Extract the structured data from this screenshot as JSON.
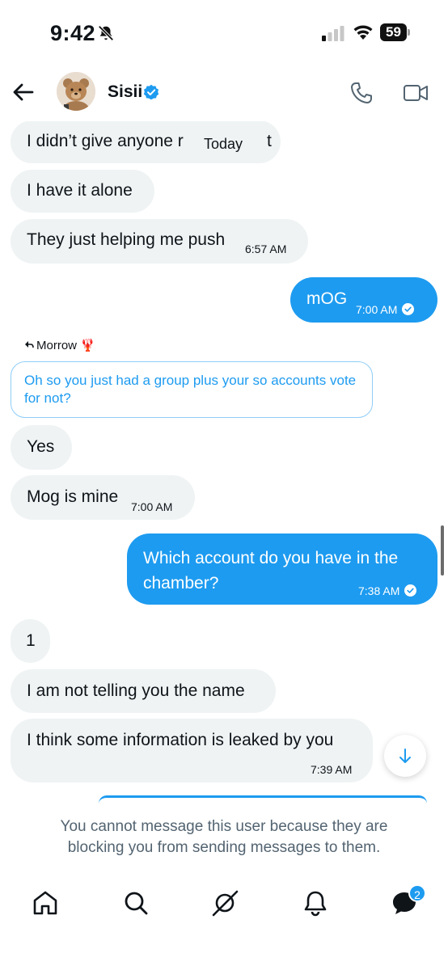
{
  "status_bar": {
    "time": "9:42",
    "battery": "59",
    "icons": [
      "bell-slash-icon",
      "cellular-signal-icon",
      "wifi-icon",
      "battery-icon"
    ]
  },
  "header": {
    "name": "Sisii",
    "verified": true,
    "icons": [
      "back-arrow-icon",
      "avatar",
      "verified-badge-icon",
      "phone-icon",
      "video-camera-icon"
    ]
  },
  "date_divider": "Today",
  "messages": {
    "m1": {
      "text": "I didn’t give anyone r",
      "tail": "t"
    },
    "m2": {
      "text": "I have it alone"
    },
    "m3": {
      "text": "They just helping me push",
      "time": "6:57 AM"
    },
    "m4": {
      "text": "mOG",
      "time": "7:00 AM"
    },
    "reply_to": {
      "name": "Morrow",
      "emoji": "🦞",
      "quote": "Oh so you just had a group plus your so accounts vote for not?"
    },
    "m5": {
      "text": "Yes"
    },
    "m6": {
      "text": "Mog is mine",
      "time": "7:00 AM"
    },
    "m7": {
      "text": "Which account do you have in the chamber?",
      "time": "7:38 AM"
    },
    "m8": {
      "text": "1"
    },
    "m9": {
      "text": "I am not telling you the name"
    },
    "m10": {
      "text": "I think some information is leaked by you",
      "time": "7:39 AM"
    }
  },
  "blocked_notice": "You cannot message this user because they are blocking you from sending messages to them.",
  "tabbar": {
    "items": [
      "home-icon",
      "search-icon",
      "grok-icon",
      "notifications-bell-icon",
      "messages-icon"
    ],
    "messages_badge": "2"
  },
  "colors": {
    "accent": "#1d9bf0",
    "incoming_bubble": "#eff3f4",
    "muted_text": "#536471"
  }
}
